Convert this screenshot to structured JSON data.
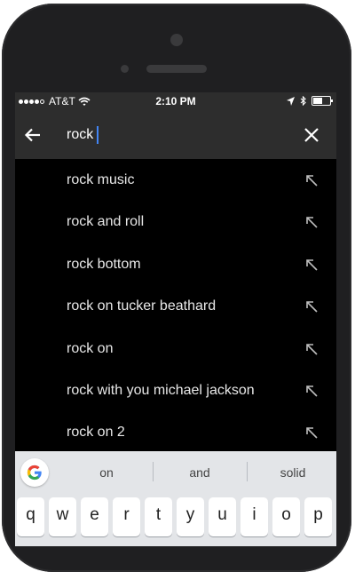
{
  "status_bar": {
    "carrier": "AT&T",
    "time": "2:10 PM",
    "battery_level": 0.55
  },
  "search": {
    "query": "rock",
    "back_icon": "arrow-left-icon",
    "clear_icon": "close-icon"
  },
  "suggestions": [
    {
      "text": "rock music",
      "icon": "arrow-up-left-icon"
    },
    {
      "text": "rock and roll",
      "icon": "arrow-up-left-icon"
    },
    {
      "text": "rock bottom",
      "icon": "arrow-up-left-icon"
    },
    {
      "text": "rock on tucker beathard",
      "icon": "arrow-up-left-icon"
    },
    {
      "text": "rock on",
      "icon": "arrow-up-left-icon"
    },
    {
      "text": "rock with you michael jackson",
      "icon": "arrow-up-left-icon"
    },
    {
      "text": "rock on 2",
      "icon": "arrow-up-left-icon"
    }
  ],
  "keyboard": {
    "suggestions": [
      "on",
      "and",
      "solid"
    ],
    "row1": [
      "q",
      "w",
      "e",
      "r",
      "t",
      "y",
      "u",
      "i",
      "o",
      "p"
    ]
  },
  "colors": {
    "screen_bg": "#000000",
    "bar_bg": "#2d2d2d",
    "caret": "#4285f4",
    "keyboard_bg": "#e3e5e8"
  }
}
